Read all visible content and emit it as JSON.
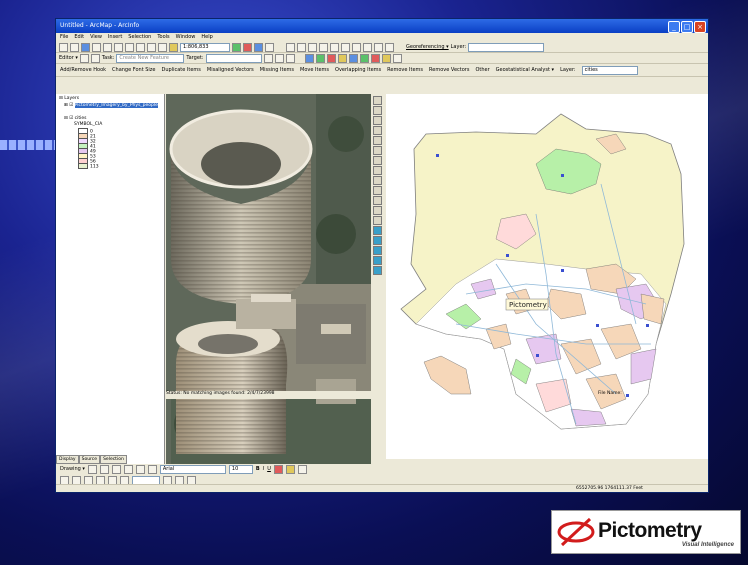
{
  "window": {
    "title": "Untitled - ArcMap - ArcInfo"
  },
  "menu": [
    "File",
    "Edit",
    "View",
    "Insert",
    "Selection",
    "Tools",
    "Window",
    "Help"
  ],
  "toolbar1": {
    "scale_value": "1:806,833",
    "georef_label": "Georeferencing ▾",
    "layer_label": "Layer:"
  },
  "toolbar2": {
    "editor_label": "Editor ▾",
    "task_value": "Create New Feature",
    "target_label": "Target:"
  },
  "toolbar3": {
    "items": [
      "Add/Remove Hook",
      "Change Font Size",
      "Duplicate Items",
      "Misaligned Vectors",
      "Missing Items",
      "Move Items",
      "Overlapping Items",
      "Remove Items",
      "Remove Vectors",
      "Other",
      "Geostatistical Analyst ▾",
      "Layer:"
    ],
    "layer_value": "cities"
  },
  "toc": {
    "root_label": "Layers",
    "layer1_label": "Pictometry_Imagery_by_Phys_people",
    "layer2_label": "cities",
    "field_label": "SYMBOL_CIA",
    "classes": [
      {
        "label": "0",
        "color": "#ffffff"
      },
      {
        "label": "21",
        "color": "#f6d7b9"
      },
      {
        "label": "32",
        "color": "#f0d9ff"
      },
      {
        "label": "41",
        "color": "#c6f2c0"
      },
      {
        "label": "49",
        "color": "#e6c8f0"
      },
      {
        "label": "53",
        "color": "#fff3c4"
      },
      {
        "label": "56",
        "color": "#ffd1d1"
      },
      {
        "label": "113",
        "color": "#e8f1d0"
      }
    ],
    "tabs": [
      "Display",
      "Source",
      "Selection"
    ]
  },
  "map": {
    "annotation": "Pictometry",
    "colors": {
      "county_fill": "#f6f3c8",
      "city_orange": "#f6d7b9",
      "city_green": "#b7f0a8",
      "city_purple": "#e6c8f0",
      "city_pink": "#ffdada",
      "road": "#8fb8d8",
      "outline": "#7f7f7f"
    }
  },
  "status": {
    "aerial_text": "Status: No matching images found: 2/4/7/23998",
    "file_name": "File Name:",
    "coords": "6552705.96 1764111.37 Feet"
  },
  "drawing": {
    "drawing_label": "Drawing ▾",
    "font_value": "Arial",
    "size_value": "10"
  },
  "logo": {
    "name": "Pictometry",
    "tagline": "Visual Intelligence"
  }
}
